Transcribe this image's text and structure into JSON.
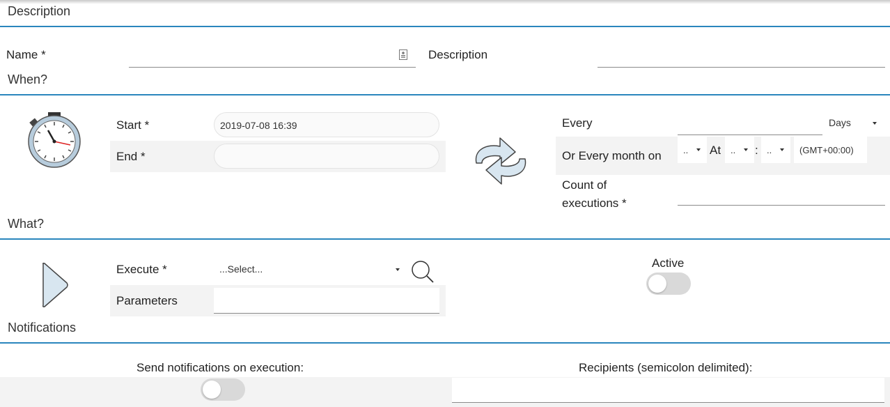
{
  "sections": {
    "description": "Description",
    "when": "When?",
    "what": "What?",
    "notifications": "Notifications"
  },
  "description": {
    "name_label": "Name *",
    "name_value": "",
    "description_label": "Description",
    "description_value": ""
  },
  "when": {
    "start_label": "Start *",
    "start_value": "2019-07-08 16:39",
    "end_label": "End *",
    "end_value": "",
    "every_label": "Every",
    "every_value": "",
    "every_unit": "Days",
    "monthly_label": "Or Every month on",
    "day_select": "..",
    "at_label": "At",
    "hour_select": "..",
    "time_separator": ":",
    "minute_select": "..",
    "timezone": "(GMT+00:00)",
    "count_label_line1": "Count of",
    "count_label_line2": "executions *",
    "count_value": ""
  },
  "what": {
    "execute_label": "Execute *",
    "execute_placeholder": "...Select...",
    "parameters_label": "Parameters",
    "parameters_value": "",
    "active_label": "Active",
    "active_on": false
  },
  "notifications": {
    "send_label": "Send notifications on execution:",
    "send_on": false,
    "recipients_label": "Recipients (semicolon delimited):",
    "recipients_value": ""
  },
  "icons": {
    "stopwatch": "stopwatch-icon",
    "repeat": "repeat-icon",
    "play": "play-icon",
    "search": "search-icon",
    "name_field": "contact-card-icon"
  },
  "colors": {
    "section_line": "#2a86bd",
    "row_background": "#f3f3f3",
    "toggle_off": "#d9d9d9"
  }
}
